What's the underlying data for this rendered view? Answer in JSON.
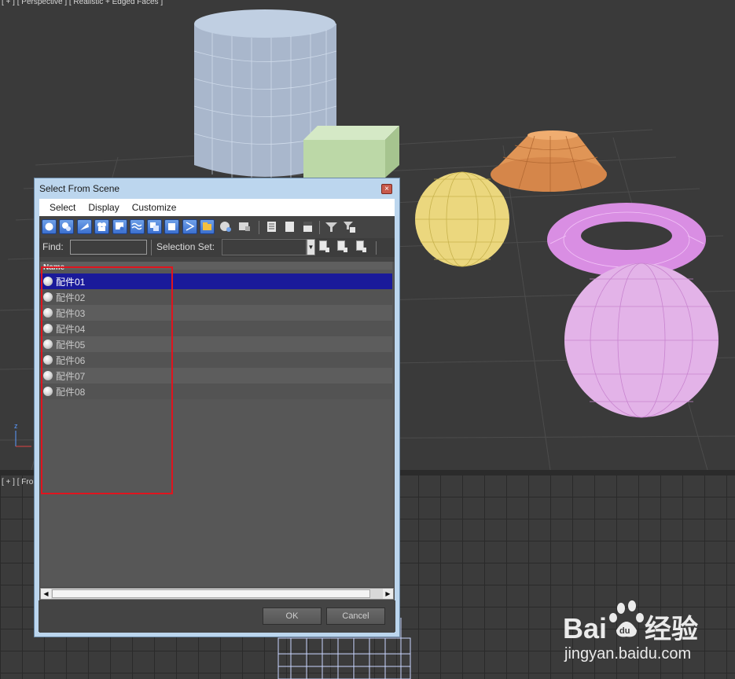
{
  "viewport_top": {
    "label": "[ + ] [ Perspective ] [ Realistic + Edged Faces ]"
  },
  "viewport_bottom": {
    "label": "[ + ] [ Fro"
  },
  "dialog": {
    "title": "Select From Scene",
    "close_glyph": "×",
    "menu": [
      "Select",
      "Display",
      "Customize"
    ],
    "find_label": "Find:",
    "find_value": "",
    "selection_set_label": "Selection Set:",
    "selection_set_value": "",
    "list_header": "Name",
    "items": [
      "配件01",
      "配件02",
      "配件03",
      "配件04",
      "配件05",
      "配件06",
      "配件07",
      "配件08"
    ],
    "selected_index": 0,
    "ok_label": "OK",
    "cancel_label": "Cancel"
  },
  "watermark": {
    "brand": "Bai",
    "brand_tail": "du",
    "product": "经验",
    "url": "jingyan.baidu.com"
  },
  "colors": {
    "selection": "#1a1a9a",
    "annotation": "#e0141e",
    "accent_blue": "#3a6fcf"
  },
  "icons": {
    "toolbar": [
      "display-geometry-icon",
      "display-shapes-icon",
      "display-lights-icon",
      "display-cameras-icon",
      "display-helpers-icon",
      "display-spacewarps-icon",
      "display-groups-icon",
      "display-xrefs-icon",
      "display-bones-icon",
      "display-containers-icon",
      "display-frozen-icon",
      "display-hidden-icon",
      "select-all-icon",
      "select-none-icon",
      "select-invert-icon",
      "filter-icon",
      "filter-options-icon"
    ]
  }
}
